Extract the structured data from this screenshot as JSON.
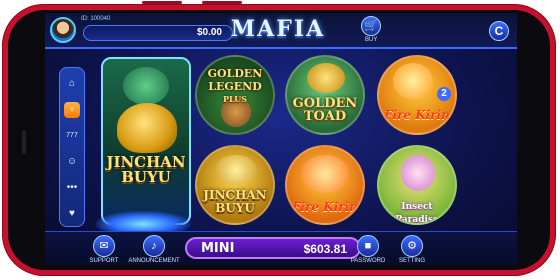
{
  "header": {
    "player_id": "ID: 100040",
    "balance": "$0.00",
    "logo": "MAFIA",
    "buy_label": "BUY"
  },
  "games": {
    "featured": {
      "title_line1": "JINCHAN",
      "title_line2": "BUYU"
    },
    "tiles": [
      {
        "line1": "GOLDEN",
        "line2": "LEGEND",
        "line3": "PLUS"
      },
      {
        "line1": "GOLDEN",
        "line2": "TOAD"
      },
      {
        "line1": "Fire Kirin",
        "badge": "2"
      },
      {
        "line1": "JINCHAN",
        "line2": "BUYU"
      },
      {
        "line1": "Fire Kirin"
      },
      {
        "line1": "Insect Paradise"
      }
    ]
  },
  "footer": {
    "support": "SUPPORT",
    "announcement": "ANNOUNCEMENT",
    "jackpot_label": "MINI",
    "jackpot_amount": "$603.81",
    "password": "PASSWORD",
    "setting": "SETTING"
  },
  "colors": {
    "phone_frame": "#c8102e",
    "accent_blue": "#3b6cff",
    "gold": "#ffe27a",
    "jackpot_purple": "#6b1fd0"
  }
}
